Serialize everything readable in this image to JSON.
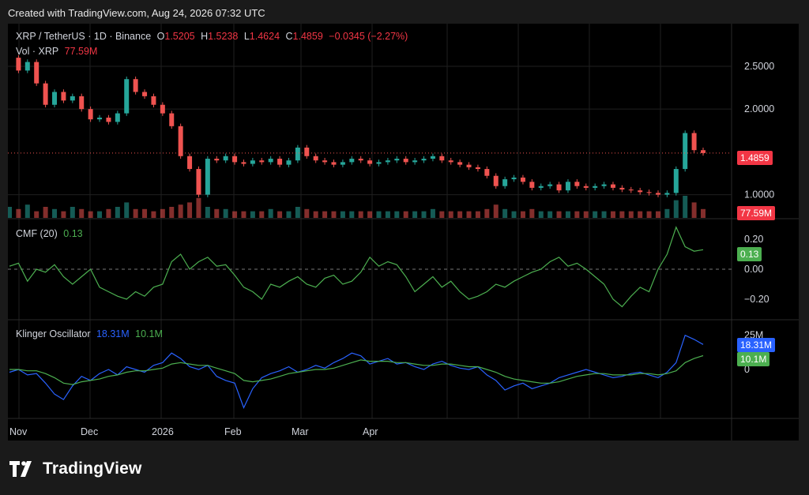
{
  "header": {
    "created": "Created with TradingView.com, Aug 24, 2026 07:32 UTC"
  },
  "legend": {
    "symbol": "XRP / TetherUS · 1D · Binance",
    "o_label": "O",
    "o_value": "1.5205",
    "h_label": "H",
    "h_value": "1.5238",
    "l_label": "L",
    "l_value": "1.4624",
    "c_label": "C",
    "c_value": "1.4859",
    "change": "−0.0345 (−2.27%)",
    "vol_label": "Vol · XRP",
    "vol_value": "77.59M",
    "cmf_label": "CMF (20)",
    "cmf_value": "0.13",
    "kvo_label": "Klinger Oscillator",
    "kvo_value": "18.31M",
    "kvo_signal": "10.1M"
  },
  "tags": {
    "price": "1.4859",
    "volume": "77.59M",
    "cmf": "0.13",
    "kvo": "18.31M",
    "kvo_signal": "10.1M"
  },
  "colors": {
    "up": "#26a69a",
    "down": "#ef5350",
    "cmf": "#4caf50",
    "kvo": "#2962ff",
    "kvo_signal": "#4caf50",
    "price_tag": "#f23645"
  },
  "footer": {
    "brand": "TradingView"
  },
  "chart_data": [
    {
      "type": "candlestick",
      "x_ticks": [
        "Nov",
        "Dec",
        "2026",
        "Feb",
        "Mar",
        "Apr"
      ],
      "y_ticks": [
        "2.5000",
        "2.0000",
        "1.0000"
      ],
      "ylim": [
        0.95,
        2.85
      ],
      "last_close": 1.4859,
      "close_path": [
        2.6,
        2.45,
        2.55,
        2.3,
        2.05,
        2.2,
        2.1,
        2.15,
        2.0,
        1.88,
        1.9,
        1.85,
        1.95,
        2.35,
        2.2,
        2.15,
        2.05,
        1.95,
        1.8,
        1.45,
        1.3,
        1.0,
        1.42,
        1.4,
        1.45,
        1.38,
        1.36,
        1.4,
        1.38,
        1.42,
        1.35,
        1.4,
        1.55,
        1.45,
        1.4,
        1.38,
        1.35,
        1.38,
        1.42,
        1.4,
        1.36,
        1.38,
        1.4,
        1.42,
        1.38,
        1.4,
        1.42,
        1.45,
        1.4,
        1.38,
        1.35,
        1.32,
        1.3,
        1.22,
        1.1,
        1.18,
        1.2,
        1.15,
        1.08,
        1.1,
        1.12,
        1.05,
        1.15,
        1.1,
        1.08,
        1.1,
        1.12,
        1.08,
        1.06,
        1.05,
        1.03,
        1.02,
        1.0,
        1.02,
        1.3,
        1.72,
        1.52,
        1.4859
      ]
    },
    {
      "type": "bar",
      "name": "Vol · XRP",
      "last": "77.59M",
      "values": [
        0.5,
        0.4,
        0.6,
        0.3,
        0.5,
        0.4,
        0.3,
        0.5,
        0.4,
        0.3,
        0.3,
        0.4,
        0.5,
        0.7,
        0.4,
        0.4,
        0.3,
        0.4,
        0.5,
        0.6,
        0.7,
        0.9,
        0.5,
        0.4,
        0.4,
        0.3,
        0.3,
        0.3,
        0.3,
        0.4,
        0.3,
        0.3,
        0.5,
        0.4,
        0.3,
        0.3,
        0.3,
        0.3,
        0.3,
        0.3,
        0.3,
        0.3,
        0.3,
        0.3,
        0.3,
        0.3,
        0.3,
        0.4,
        0.3,
        0.3,
        0.3,
        0.3,
        0.3,
        0.4,
        0.6,
        0.4,
        0.3,
        0.3,
        0.4,
        0.3,
        0.3,
        0.3,
        0.3,
        0.3,
        0.3,
        0.3,
        0.3,
        0.3,
        0.3,
        0.3,
        0.3,
        0.3,
        0.3,
        0.4,
        0.8,
        1.0,
        0.7,
        0.4
      ]
    },
    {
      "type": "line",
      "name": "CMF (20)",
      "y_ticks": [
        "0.20",
        "0.00",
        "−0.20"
      ],
      "ylim": [
        -0.3,
        0.3
      ],
      "last": 0.13,
      "values": [
        0.02,
        0.04,
        -0.08,
        0.0,
        -0.02,
        0.03,
        -0.05,
        -0.1,
        -0.05,
        0.0,
        -0.12,
        -0.15,
        -0.18,
        -0.2,
        -0.15,
        -0.18,
        -0.12,
        -0.1,
        0.05,
        0.1,
        0.0,
        0.05,
        0.08,
        0.02,
        0.03,
        -0.04,
        -0.12,
        -0.15,
        -0.2,
        -0.1,
        -0.12,
        -0.08,
        -0.05,
        -0.1,
        -0.12,
        -0.06,
        -0.04,
        -0.1,
        -0.08,
        -0.02,
        0.08,
        0.02,
        0.05,
        0.03,
        -0.05,
        -0.15,
        -0.1,
        -0.05,
        -0.12,
        -0.08,
        -0.15,
        -0.2,
        -0.18,
        -0.15,
        -0.1,
        -0.12,
        -0.08,
        -0.05,
        -0.02,
        0.0,
        0.05,
        0.08,
        0.02,
        0.04,
        0.0,
        -0.05,
        -0.1,
        -0.2,
        -0.25,
        -0.18,
        -0.12,
        -0.15,
        0.0,
        0.1,
        0.28,
        0.15,
        0.12,
        0.13
      ]
    },
    {
      "type": "line",
      "name": "Klinger Oscillator",
      "y_ticks": [
        "25M",
        "0"
      ],
      "ylim": [
        -30,
        30
      ],
      "series": [
        {
          "name": "Klinger Oscillator",
          "last": "18.31M",
          "values": [
            -2,
            0,
            -4,
            -3,
            -10,
            -18,
            -22,
            -12,
            -5,
            -8,
            -3,
            0,
            -4,
            2,
            0,
            -2,
            3,
            5,
            12,
            8,
            2,
            0,
            3,
            -5,
            -8,
            -10,
            -28,
            -14,
            -6,
            -3,
            -1,
            2,
            -2,
            0,
            3,
            1,
            5,
            8,
            12,
            10,
            4,
            6,
            8,
            4,
            5,
            2,
            0,
            4,
            6,
            3,
            1,
            0,
            2,
            -4,
            -8,
            -15,
            -12,
            -10,
            -14,
            -12,
            -10,
            -6,
            -4,
            -2,
            0,
            -2,
            -4,
            -6,
            -5,
            -3,
            -2,
            -4,
            -6,
            -2,
            5,
            25,
            22,
            18.31
          ]
        },
        {
          "name": "Klinger Signal",
          "last": "10.1M",
          "values": [
            0,
            0,
            -1,
            -1,
            -3,
            -6,
            -10,
            -11,
            -9,
            -8,
            -7,
            -5,
            -4,
            -2,
            -1,
            -1,
            0,
            1,
            4,
            5,
            4,
            3,
            3,
            1,
            -1,
            -3,
            -8,
            -9,
            -8,
            -7,
            -5,
            -3,
            -2,
            -1,
            0,
            0,
            1,
            3,
            5,
            7,
            6,
            6,
            6,
            5,
            5,
            4,
            3,
            3,
            4,
            4,
            3,
            2,
            2,
            0,
            -2,
            -5,
            -7,
            -8,
            -9,
            -10,
            -10,
            -9,
            -7,
            -5,
            -4,
            -3,
            -3,
            -4,
            -4,
            -4,
            -3,
            -3,
            -4,
            -3,
            -1,
            5,
            8,
            10.1
          ]
        }
      ]
    }
  ]
}
